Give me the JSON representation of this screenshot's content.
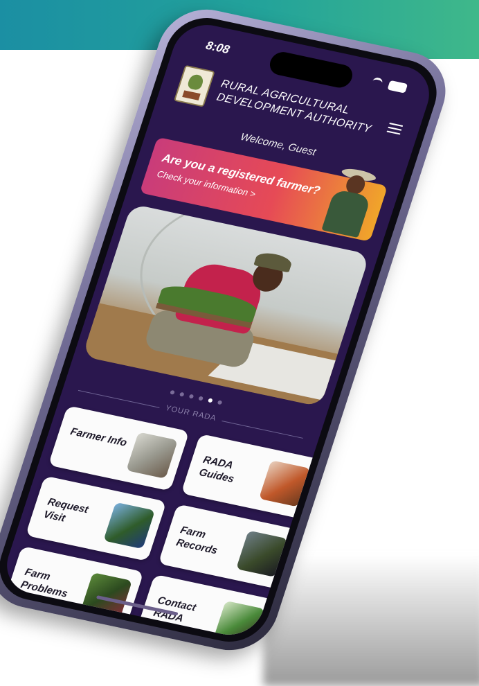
{
  "status_bar": {
    "time": "8:08"
  },
  "header": {
    "title": "RURAL AGRICULTURAL DEVELOPMENT AUTHORITY"
  },
  "welcome": "Welcome, Guest",
  "promo": {
    "title": "Are you a registered farmer?",
    "subtitle": "Check your information >"
  },
  "carousel": {
    "dot_count": 6,
    "active_index": 4
  },
  "section_label": "YOUR RADA",
  "tiles": [
    {
      "label": "Farmer Info"
    },
    {
      "label": "RADA Guides"
    },
    {
      "label": "Request Visit"
    },
    {
      "label": "Farm Records"
    },
    {
      "label": "Farm Problems"
    },
    {
      "label": "Contact RADA"
    }
  ],
  "colors": {
    "screen_bg": "#2a174e",
    "promo_start": "#c93c7a",
    "promo_end": "#f0a52a",
    "accent_teal": "#23a39a"
  }
}
